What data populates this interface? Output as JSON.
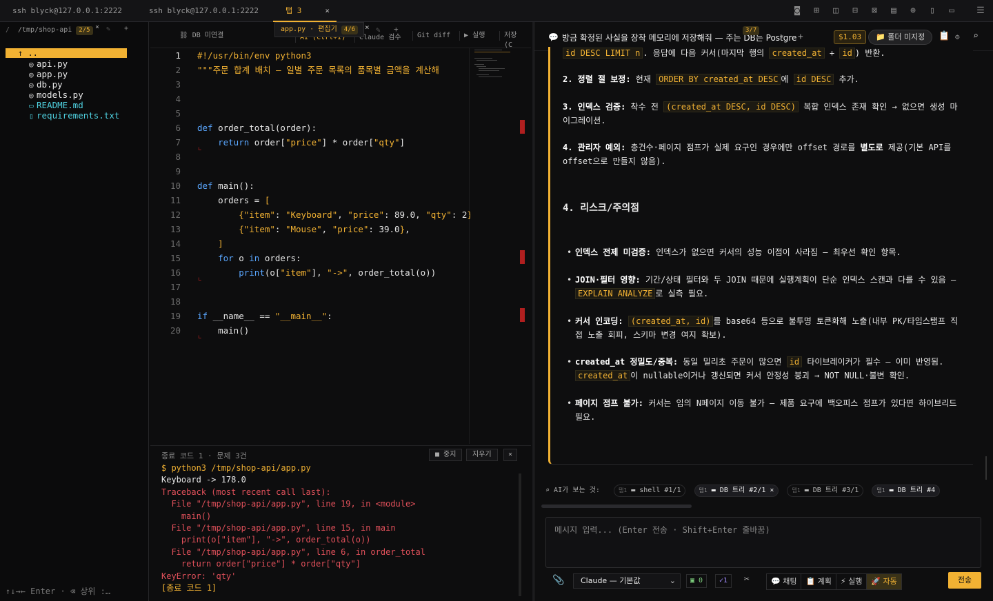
{
  "topbar": {
    "tabs": [
      {
        "label": "ssh blyck@127.0.0.1:2222"
      },
      {
        "label": "ssh blyck@127.0.0.1:2222"
      },
      {
        "label": "탭 3",
        "close": "×"
      }
    ]
  },
  "filepanel": {
    "path": "/tmp/shop-api",
    "badge": "2/5",
    "close": "×",
    "up": "↑  ..",
    "files": [
      {
        "name": "api.py",
        "icon": "python-icon"
      },
      {
        "name": "app.py",
        "icon": "python-icon"
      },
      {
        "name": "db.py",
        "icon": "python-icon"
      },
      {
        "name": "models.py",
        "icon": "python-icon"
      },
      {
        "name": "README.md",
        "icon": "markdown-icon"
      },
      {
        "name": "requirements.txt",
        "icon": "file-icon"
      }
    ],
    "footer": "↑↓→← Enter · ⌫ 상위 :…"
  },
  "editor": {
    "tools": {
      "db": "DB 미연결",
      "ai": "AI (Ctrl+I)",
      "claude": "Claude 검수",
      "gitdiff": "Git diff",
      "run": "▶ 실행",
      "save": "저장 (C"
    },
    "float": {
      "file": "app.py · 편집기",
      "badge": "4/6",
      "close": "×"
    },
    "lines": [
      "1",
      "2",
      "3",
      "4",
      "5",
      "6",
      "7",
      "8",
      "9",
      "10",
      "11",
      "12",
      "13",
      "14",
      "15",
      "16",
      "17",
      "18",
      "19",
      "20"
    ]
  },
  "terminal": {
    "header": "종료 코드 1 · 문제 3건",
    "stop": "■ 중지",
    "clear": "지우기",
    "close": "×",
    "lines": [
      "$ python3 /tmp/shop-api/app.py",
      "Keyboard -> 178.0",
      "Traceback (most recent call last):",
      "  File \"/tmp/shop-api/app.py\", line 19, in <module>",
      "    main()",
      "  File \"/tmp/shop-api/app.py\", line 15, in main",
      "    print(o[\"item\"], \"->\", order_total(o))",
      "  File \"/tmp/shop-api/app.py\", line 6, in order_total",
      "    return order[\"price\"] * order[\"qty\"]",
      "KeyError: 'qty'",
      "[종료 코드 1]"
    ]
  },
  "chat": {
    "title": "방금 확정된 사실을 장착 메모리에 저장해줘 — 주는 DB는 Postgre",
    "cell_badge": "3/7",
    "cost": "$1.03",
    "folder": "📁 폴더 미지정",
    "top_line": {
      "a": "id DESC LIMIT n",
      "b": ". 응답에 다음 커서(마지막 행의 ",
      "c": "created_at",
      "d": " + ",
      "e": "id",
      "f": ") 반환."
    },
    "items": {
      "i2": {
        "num": "2. 정렬 절 보정:",
        "t1": " 현재 ",
        "c1": "ORDER BY created_at DESC",
        "t2": "에 ",
        "c2": "id DESC",
        "t3": " 추가."
      },
      "i3": {
        "num": "3. 인덱스 검증:",
        "t1": " 착수 전 ",
        "c1": "(created_at DESC, id DESC)",
        "t2": " 복합 인덱스 존재 확인 → 없으면 생성 마이그레이션."
      },
      "i4": {
        "num": "4. 관리자 예외:",
        "t1": " 총건수·페이지 점프가 실제 요구인 경우에만 offset 경로를 ",
        "b1": "별도로",
        "t2": " 제공(기본 API를 offset으로 만들지 않음)."
      }
    },
    "section": "4. 리스크/주의점",
    "risks": {
      "r1": {
        "b": "인덱스 전제 미검증:",
        "t": " 인덱스가 없으면 커서의 성능 이점이 사라짐 — 최우선 확인 항목."
      },
      "r2": {
        "b": "JOIN·필터 영향:",
        "t1": " 기간/상태 필터와 두 JOIN 때문에 실행계획이 단순 인덱스 스캔과 다를 수 있음 — ",
        "c": "EXPLAIN ANALYZE",
        "t2": "로 실측 필요."
      },
      "r3": {
        "b": "커서 인코딩:",
        "t1": " ",
        "c": "(created_at, id)",
        "t2": "를 base64 등으로 불투명 토큰화해 노출(내부 PK/타임스탬프 직접 노출 회피, 스키마 변경 여지 확보)."
      },
      "r4": {
        "b": "created_at 정밀도/중복:",
        "t1": " 동일 밀리초 주문이 많으면 ",
        "c1": "id",
        "t2": " 타이브레이커가 필수 — 이미 반영됨. ",
        "c2": "created_at",
        "t3": "이 nullable이거나 갱신되면 커서 안정성 붕괴 → NOT NULL·불변 확인."
      },
      "r5": {
        "b": "페이지 점프 불가:",
        "t": " 커서는 임의 N페이지 이동 불가 — 제품 요구에 백오피스 점프가 있다면 하이브리드 필요."
      }
    },
    "aisee": {
      "label": "AI가 보는 것:",
      "chips": [
        "shell #1/1",
        "DB 트리 #2/1",
        "DB 트리 #3/1",
        "DB 트리 #4"
      ],
      "tab_tags": [
        "탭1",
        "탭1",
        "탭1",
        "탭1"
      ],
      "chip_close": "×"
    },
    "input_placeholder": "메시지 입력... (Enter 전송 · Shift+Enter 줄바꿈)",
    "model": "Claude — 기본값",
    "count_a": "0",
    "count_b": "1",
    "modes": [
      "💬 채팅",
      "📋 계획",
      "⚡ 실행",
      "🚀 자동"
    ],
    "send": "전송"
  },
  "colors": {
    "accent": "#f2b233",
    "error": "#e0505a",
    "keyword": "#5aa7ff"
  }
}
